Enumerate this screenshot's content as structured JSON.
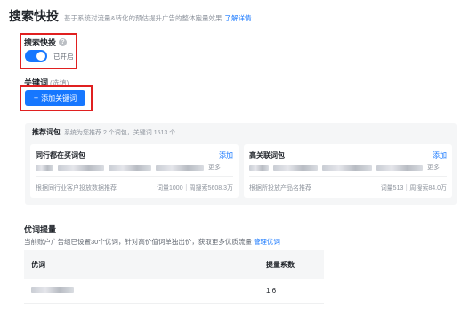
{
  "header": {
    "title": "搜索快投",
    "subtitle": "基于系统对流量&转化的预估提升广告的整体跑量效果",
    "link": "了解详情"
  },
  "toggle": {
    "label": "搜索快投",
    "help_icon": "question-circle-icon",
    "status": "已开启",
    "on": true
  },
  "keywords": {
    "label": "关键词",
    "optional": "(选填)",
    "add_button": "添加关键词",
    "add_icon": "plus-icon"
  },
  "recommend": {
    "title": "推荐词包",
    "description": "系统为您推荐 2 个词包，关键词 1513 个",
    "packages": [
      {
        "name": "同行都在买词包",
        "add": "添加",
        "more": "更多",
        "source": "根据同行业客户投放数据推荐",
        "stats": "词量1000｜周搜索5608.3万"
      },
      {
        "name": "高关联词包",
        "add": "添加",
        "more": "更多",
        "source": "根据所投放产品名推荐",
        "stats": "词量513｜周搜索84.0万"
      }
    ]
  },
  "optimize": {
    "title": "优词提量",
    "description": "当前账户广告组已设置30个优词，针对高价值词单独出价，获取更多优质流量",
    "link": "管理优词",
    "table": {
      "columns": [
        "优词",
        "提量系数"
      ],
      "rows": [
        {
          "coefficient": "1.6"
        }
      ]
    }
  },
  "colors": {
    "accent": "#1677ff",
    "highlight": "#e02020",
    "panel": "#f5f6f7"
  }
}
